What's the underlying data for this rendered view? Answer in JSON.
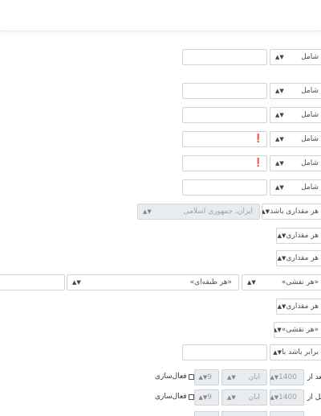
{
  "filters": {
    "row1": {
      "operator": "شامل"
    },
    "row2": {
      "operator": "شامل"
    },
    "row3": {
      "operator": "شامل"
    },
    "row4": {
      "operator": "شامل"
    },
    "row5": {
      "operator": "شامل"
    },
    "row6": {
      "operator": "شامل"
    },
    "country": {
      "operator": "هر مقداری باشد",
      "value": "ایران، جمهوری اسلامی"
    },
    "any1": {
      "operator": "هر مقداری"
    },
    "any2": {
      "operator": "هر مقداری"
    },
    "roles": {
      "category": "«هر طبقه‌ای»",
      "role": "«هر نقشی»"
    },
    "any3": {
      "operator": "هر مقداری"
    },
    "role2": {
      "operator": "«هر نقشی»"
    },
    "equal": {
      "operator": "برابر باشد با"
    },
    "date_after": {
      "label": "بعد از",
      "year": "1400",
      "month": "ابان",
      "day": "9",
      "enable": "فعال‌سازی"
    },
    "date_before": {
      "label": "قبل از",
      "year": "1400",
      "month": "ابان",
      "day": "9",
      "enable": "فعال‌سازی"
    }
  }
}
